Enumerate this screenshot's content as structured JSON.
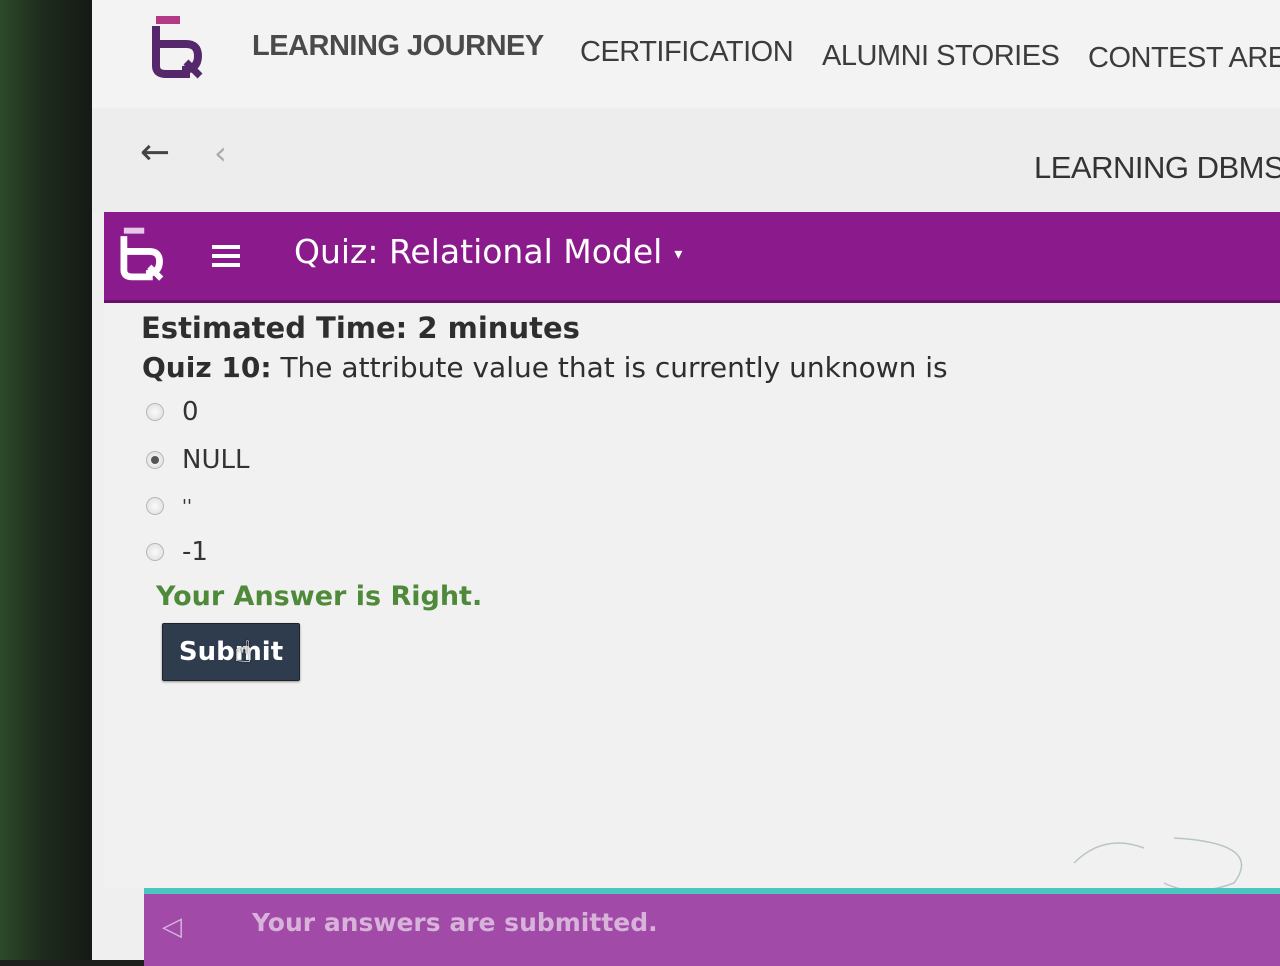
{
  "header": {
    "nav": [
      {
        "label": "LEARNING JOURNEY",
        "active": true
      },
      {
        "label": "CERTIFICATION",
        "active": false
      },
      {
        "label": "ALUMNI STORIES",
        "active": false
      },
      {
        "label": "CONTEST AREN",
        "active": false
      }
    ]
  },
  "subbar": {
    "course_title": "LEARNING DBMS /"
  },
  "quiz_header": {
    "title": "Quiz: Relational Model"
  },
  "quiz": {
    "estimated_label": "Estimated Time:",
    "estimated_value": "2 minutes",
    "question_number": "Quiz 10:",
    "question_text": "The attribute value that is currently unknown is",
    "options": [
      {
        "label": "0",
        "selected": false
      },
      {
        "label": "NULL",
        "selected": true
      },
      {
        "label": "''",
        "selected": false
      },
      {
        "label": "-1",
        "selected": false
      }
    ],
    "result": "Your Answer is Right.",
    "submit_label": "Submit"
  },
  "footer": {
    "message": "Your answers are submitted."
  },
  "colors": {
    "brand_purple": "#8b1a8c",
    "footer_purple": "#a24aa8",
    "success_green": "#4f8a3a",
    "button_dark": "#2f3c4d",
    "footer_accent": "#4cc6c0"
  }
}
